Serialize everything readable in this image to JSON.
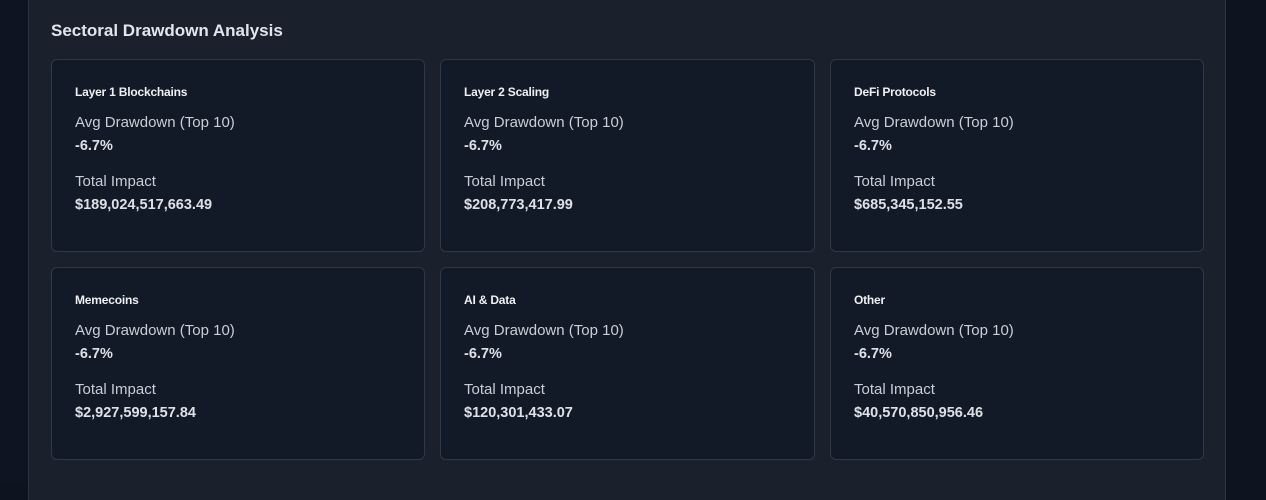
{
  "section": {
    "title": "Sectoral Drawdown Analysis"
  },
  "cards": [
    {
      "name": "Layer 1 Blockchains",
      "avg_label": "Avg Drawdown (Top 10)",
      "avg_value": "-6.7%",
      "impact_label": "Total Impact",
      "impact_value": "$189,024,517,663.49"
    },
    {
      "name": "Layer 2 Scaling",
      "avg_label": "Avg Drawdown (Top 10)",
      "avg_value": "-6.7%",
      "impact_label": "Total Impact",
      "impact_value": "$208,773,417.99"
    },
    {
      "name": "DeFi Protocols",
      "avg_label": "Avg Drawdown (Top 10)",
      "avg_value": "-6.7%",
      "impact_label": "Total Impact",
      "impact_value": "$685,345,152.55"
    },
    {
      "name": "Memecoins",
      "avg_label": "Avg Drawdown (Top 10)",
      "avg_value": "-6.7%",
      "impact_label": "Total Impact",
      "impact_value": "$2,927,599,157.84"
    },
    {
      "name": "AI & Data",
      "avg_label": "Avg Drawdown (Top 10)",
      "avg_value": "-6.7%",
      "impact_label": "Total Impact",
      "impact_value": "$120,301,433.07"
    },
    {
      "name": "Other",
      "avg_label": "Avg Drawdown (Top 10)",
      "avg_value": "-6.7%",
      "impact_label": "Total Impact",
      "impact_value": "$40,570,850,956.46"
    }
  ]
}
